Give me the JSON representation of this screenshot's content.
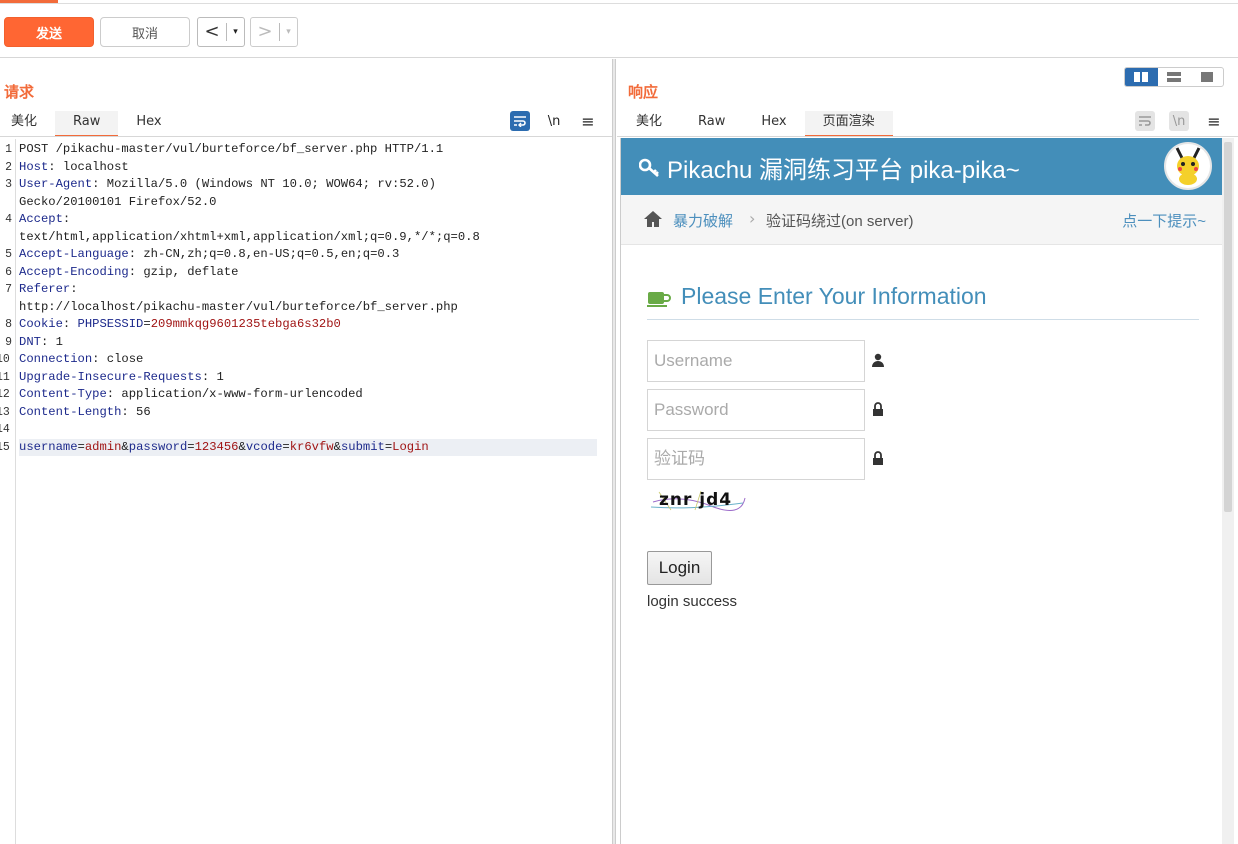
{
  "toolbar": {
    "send_label": "发送",
    "cancel_label": "取消",
    "back_glyph": "<",
    "forward_glyph": ">",
    "dropdown_glyph": "▾"
  },
  "request": {
    "title": "请求",
    "tabs": [
      {
        "label": "美化"
      },
      {
        "label": "Raw"
      },
      {
        "label": "Hex"
      }
    ],
    "active_tab": "Raw",
    "newline_label": "\\n",
    "lines": [
      {
        "n": "1",
        "parts": [
          {
            "t": "POST /pikachu-master/vul/burteforce/bf_server.php HTTP/1.1",
            "c": "plain"
          }
        ]
      },
      {
        "n": "2",
        "parts": [
          {
            "t": "Host",
            "c": "hn"
          },
          {
            "t": ": localhost",
            "c": "plain"
          }
        ]
      },
      {
        "n": "3",
        "parts": [
          {
            "t": "User-Agent",
            "c": "hn"
          },
          {
            "t": ": Mozilla/5.0 (Windows NT 10.0; WOW64; rv:52.0)",
            "c": "plain"
          }
        ]
      },
      {
        "n": "",
        "parts": [
          {
            "t": "Gecko/20100101 Firefox/52.0",
            "c": "plain"
          }
        ]
      },
      {
        "n": "4",
        "parts": [
          {
            "t": "Accept",
            "c": "hn"
          },
          {
            "t": ":",
            "c": "plain"
          }
        ]
      },
      {
        "n": "",
        "parts": [
          {
            "t": "text/html,application/xhtml+xml,application/xml;q=0.9,*/*;q=0.8",
            "c": "plain"
          }
        ]
      },
      {
        "n": "5",
        "parts": [
          {
            "t": "Accept-Language",
            "c": "hn"
          },
          {
            "t": ": zh-CN,zh;q=0.8,en-US;q=0.5,en;q=0.3",
            "c": "plain"
          }
        ]
      },
      {
        "n": "6",
        "parts": [
          {
            "t": "Accept-Encoding",
            "c": "hn"
          },
          {
            "t": ": gzip, deflate",
            "c": "plain"
          }
        ]
      },
      {
        "n": "7",
        "parts": [
          {
            "t": "Referer",
            "c": "hn"
          },
          {
            "t": ":",
            "c": "plain"
          }
        ]
      },
      {
        "n": "",
        "parts": [
          {
            "t": "http://localhost/pikachu-master/vul/burteforce/bf_server.php",
            "c": "plain"
          }
        ]
      },
      {
        "n": "8",
        "parts": [
          {
            "t": "Cookie",
            "c": "hn"
          },
          {
            "t": ": ",
            "c": "plain"
          },
          {
            "t": "PHPSESSID",
            "c": "hn"
          },
          {
            "t": "=",
            "c": "plain"
          },
          {
            "t": "209mmkqg9601235tebga6s32b0",
            "c": "pv"
          }
        ]
      },
      {
        "n": "9",
        "parts": [
          {
            "t": "DNT",
            "c": "hn"
          },
          {
            "t": ": 1",
            "c": "plain"
          }
        ]
      },
      {
        "n": "10",
        "parts": [
          {
            "t": "Connection",
            "c": "hn"
          },
          {
            "t": ": close",
            "c": "plain"
          }
        ]
      },
      {
        "n": "11",
        "parts": [
          {
            "t": "Upgrade-Insecure-Requests",
            "c": "hn"
          },
          {
            "t": ": 1",
            "c": "plain"
          }
        ]
      },
      {
        "n": "12",
        "parts": [
          {
            "t": "Content-Type",
            "c": "hn"
          },
          {
            "t": ": application/x-www-form-urlencoded",
            "c": "plain"
          }
        ]
      },
      {
        "n": "13",
        "parts": [
          {
            "t": "Content-Length",
            "c": "hn"
          },
          {
            "t": ": 56",
            "c": "plain"
          }
        ]
      },
      {
        "n": "14",
        "parts": [
          {
            "t": "",
            "c": "plain"
          }
        ]
      },
      {
        "n": "15",
        "parts": [
          {
            "t": "username",
            "c": "hn"
          },
          {
            "t": "=",
            "c": "plain"
          },
          {
            "t": "admin",
            "c": "pv"
          },
          {
            "t": "&",
            "c": "plain"
          },
          {
            "t": "password",
            "c": "hn"
          },
          {
            "t": "=",
            "c": "plain"
          },
          {
            "t": "123456",
            "c": "pv"
          },
          {
            "t": "&",
            "c": "plain"
          },
          {
            "t": "vcode",
            "c": "hn"
          },
          {
            "t": "=",
            "c": "plain"
          },
          {
            "t": "kr6vfw",
            "c": "pv"
          },
          {
            "t": "&",
            "c": "plain"
          },
          {
            "t": "submit",
            "c": "hn"
          },
          {
            "t": "=",
            "c": "plain"
          },
          {
            "t": "Login",
            "c": "pv"
          }
        ]
      }
    ]
  },
  "response": {
    "title": "响应",
    "tabs": [
      {
        "label": "美化"
      },
      {
        "label": "Raw"
      },
      {
        "label": "Hex"
      },
      {
        "label": "页面渲染"
      }
    ],
    "active_tab": "页面渲染",
    "newline_label": "\\n",
    "page": {
      "header_title": "Pikachu 漏洞练习平台 pika-pika~",
      "breadcrumb_home": "暴力破解",
      "breadcrumb_sep": "›",
      "breadcrumb_current": "验证码绕过(on server)",
      "hint_link": "点一下提示~",
      "form_title": "Please Enter Your Information",
      "username_placeholder": "Username",
      "password_placeholder": "Password",
      "vcode_placeholder": "验证码",
      "captcha_text": "znr jd4",
      "login_button": "Login",
      "result_message": "login success"
    }
  },
  "colors": {
    "accent": "#ff6633",
    "brand_blue": "#438eb9",
    "link": "#4c8fbd"
  }
}
